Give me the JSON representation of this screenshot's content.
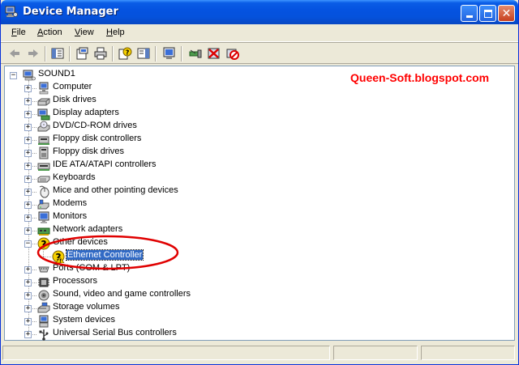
{
  "window": {
    "title": "Device Manager",
    "colors": {
      "titlebar": "#0553e0",
      "selection": "#316ac5",
      "annotation": "#ff0000"
    }
  },
  "menu": [
    {
      "label": "File",
      "accel": "F"
    },
    {
      "label": "Action",
      "accel": "A"
    },
    {
      "label": "View",
      "accel": "V"
    },
    {
      "label": "Help",
      "accel": "H"
    }
  ],
  "toolbar": {
    "buttons": [
      "back-arrow-icon",
      "forward-arrow-icon",
      "show-hide-console-tree-icon",
      "properties-icon",
      "print-icon",
      "help-icon",
      "show-hide-action-pane-icon",
      "scan-hardware-icon",
      "update-driver-icon",
      "uninstall-icon",
      "disable-device-icon"
    ]
  },
  "tree": {
    "root": "SOUND1",
    "categories": [
      {
        "label": "Computer",
        "icon": "computer-icon",
        "expanded": false
      },
      {
        "label": "Disk drives",
        "icon": "disk-drive-icon",
        "expanded": false
      },
      {
        "label": "Display adapters",
        "icon": "display-adapter-icon",
        "expanded": false
      },
      {
        "label": "DVD/CD-ROM drives",
        "icon": "cdrom-icon",
        "expanded": false
      },
      {
        "label": "Floppy disk controllers",
        "icon": "floppy-controller-icon",
        "expanded": false
      },
      {
        "label": "Floppy disk drives",
        "icon": "floppy-drive-icon",
        "expanded": false
      },
      {
        "label": "IDE ATA/ATAPI controllers",
        "icon": "ide-controller-icon",
        "expanded": false
      },
      {
        "label": "Keyboards",
        "icon": "keyboard-icon",
        "expanded": false
      },
      {
        "label": "Mice and other pointing devices",
        "icon": "mouse-icon",
        "expanded": false
      },
      {
        "label": "Modems",
        "icon": "modem-icon",
        "expanded": false
      },
      {
        "label": "Monitors",
        "icon": "monitor-icon",
        "expanded": false
      },
      {
        "label": "Network adapters",
        "icon": "network-adapter-icon",
        "expanded": false
      },
      {
        "label": "Other devices",
        "icon": "question-mark-icon",
        "expanded": true
      },
      {
        "label": "Ports (COM & LPT)",
        "icon": "port-icon",
        "expanded": false
      },
      {
        "label": "Processors",
        "icon": "processor-icon",
        "expanded": false
      },
      {
        "label": "Sound, video and game controllers",
        "icon": "sound-icon",
        "expanded": false
      },
      {
        "label": "Storage volumes",
        "icon": "storage-volume-icon",
        "expanded": false
      },
      {
        "label": "System devices",
        "icon": "system-device-icon",
        "expanded": false
      },
      {
        "label": "Universal Serial Bus controllers",
        "icon": "usb-icon",
        "expanded": false
      }
    ],
    "other_devices_child": {
      "label": "Ethernet Controller",
      "icon": "warning-question-icon",
      "selected": true
    }
  },
  "watermark": "Queen-Soft.blogspot.com"
}
